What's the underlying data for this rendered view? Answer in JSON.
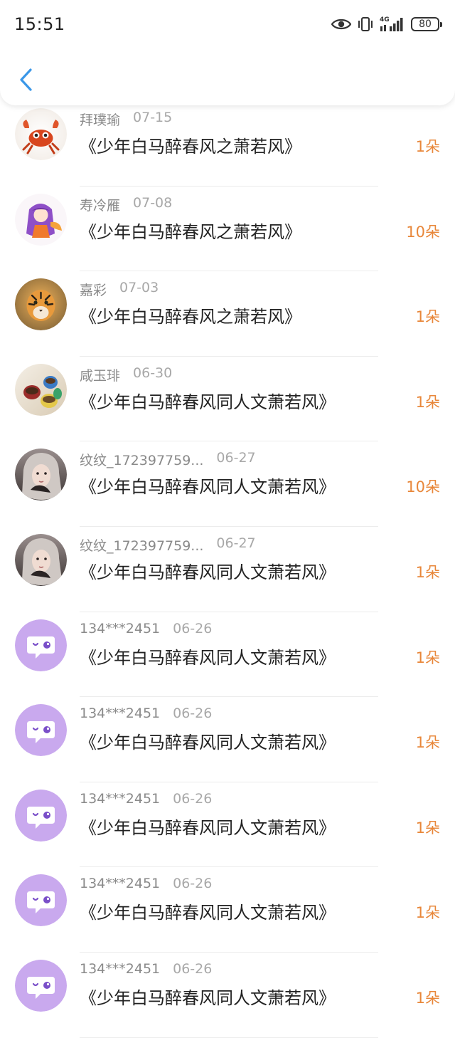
{
  "status_bar": {
    "time": "15:51",
    "network": "4G",
    "battery": "80"
  },
  "header": {
    "back_icon": "chevron-left-icon"
  },
  "colors": {
    "accent_blue": "#3a97e8",
    "gift_orange": "#e8873a",
    "default_avatar": "#c9a9ee"
  },
  "records": [
    {
      "avatar": "crab-avatar",
      "name": "拜璞瑜",
      "date": "07-15",
      "title": "《少年白马醉春风之萧若风》",
      "gift": "1朵"
    },
    {
      "avatar": "anime-girl-avatar",
      "name": "寿冷雁",
      "date": "07-08",
      "title": "《少年白马醉春风之萧若风》",
      "gift": "10朵"
    },
    {
      "avatar": "tiger-avatar",
      "name": "嘉彩",
      "date": "07-03",
      "title": "《少年白马醉春风之萧若风》",
      "gift": "1朵"
    },
    {
      "avatar": "teacups-avatar",
      "name": "咸玉琲",
      "date": "06-30",
      "title": "《少年白马醉春风同人文萧若风》",
      "gift": "1朵"
    },
    {
      "avatar": "girl-photo-avatar",
      "name": "纹纹_172397759...",
      "date": "06-27",
      "title": "《少年白马醉春风同人文萧若风》",
      "gift": "10朵"
    },
    {
      "avatar": "girl-photo-avatar",
      "name": "纹纹_172397759...",
      "date": "06-27",
      "title": "《少年白马醉春风同人文萧若风》",
      "gift": "1朵"
    },
    {
      "avatar": "default-chat-avatar",
      "name": "134***2451",
      "date": "06-26",
      "title": "《少年白马醉春风同人文萧若风》",
      "gift": "1朵"
    },
    {
      "avatar": "default-chat-avatar",
      "name": "134***2451",
      "date": "06-26",
      "title": "《少年白马醉春风同人文萧若风》",
      "gift": "1朵"
    },
    {
      "avatar": "default-chat-avatar",
      "name": "134***2451",
      "date": "06-26",
      "title": "《少年白马醉春风同人文萧若风》",
      "gift": "1朵"
    },
    {
      "avatar": "default-chat-avatar",
      "name": "134***2451",
      "date": "06-26",
      "title": "《少年白马醉春风同人文萧若风》",
      "gift": "1朵"
    },
    {
      "avatar": "default-chat-avatar",
      "name": "134***2451",
      "date": "06-26",
      "title": "《少年白马醉春风同人文萧若风》",
      "gift": "1朵"
    }
  ]
}
